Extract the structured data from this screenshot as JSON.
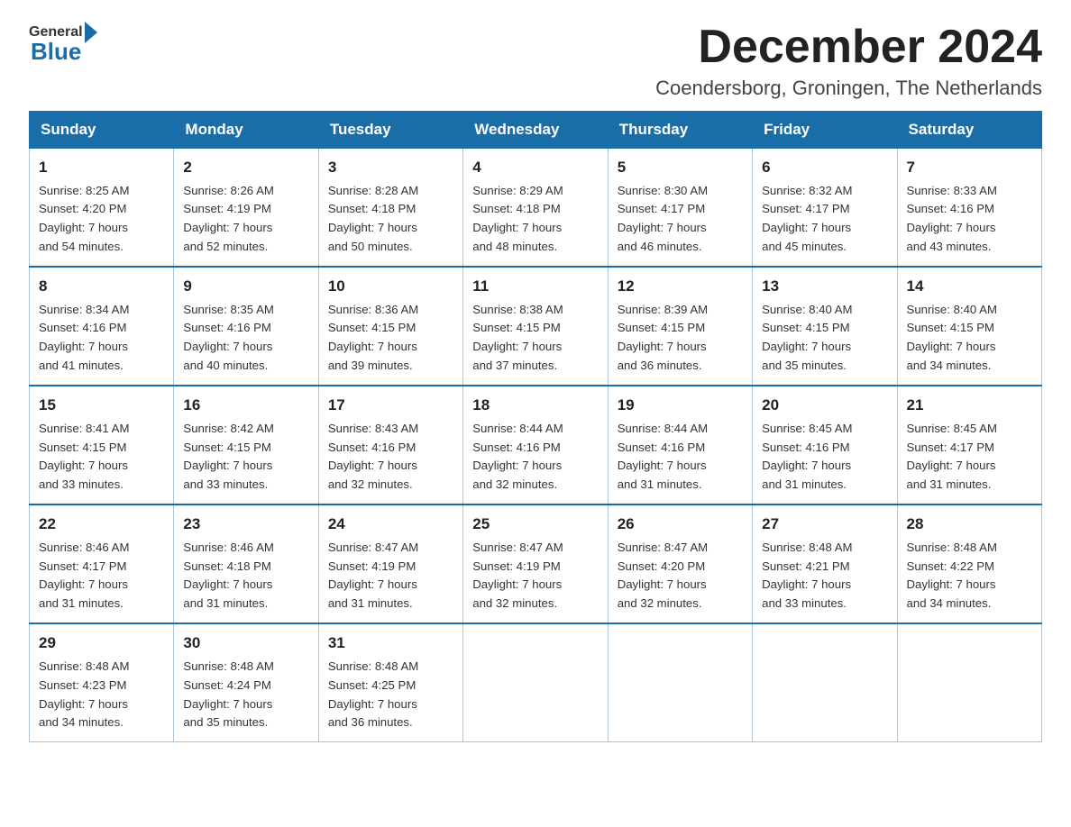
{
  "header": {
    "logo_general": "General",
    "logo_blue": "Blue",
    "month_title": "December 2024",
    "location": "Coendersborg, Groningen, The Netherlands"
  },
  "days_of_week": [
    "Sunday",
    "Monday",
    "Tuesday",
    "Wednesday",
    "Thursday",
    "Friday",
    "Saturday"
  ],
  "weeks": [
    [
      {
        "day": "1",
        "sunrise": "8:25 AM",
        "sunset": "4:20 PM",
        "daylight": "7 hours and 54 minutes."
      },
      {
        "day": "2",
        "sunrise": "8:26 AM",
        "sunset": "4:19 PM",
        "daylight": "7 hours and 52 minutes."
      },
      {
        "day": "3",
        "sunrise": "8:28 AM",
        "sunset": "4:18 PM",
        "daylight": "7 hours and 50 minutes."
      },
      {
        "day": "4",
        "sunrise": "8:29 AM",
        "sunset": "4:18 PM",
        "daylight": "7 hours and 48 minutes."
      },
      {
        "day": "5",
        "sunrise": "8:30 AM",
        "sunset": "4:17 PM",
        "daylight": "7 hours and 46 minutes."
      },
      {
        "day": "6",
        "sunrise": "8:32 AM",
        "sunset": "4:17 PM",
        "daylight": "7 hours and 45 minutes."
      },
      {
        "day": "7",
        "sunrise": "8:33 AM",
        "sunset": "4:16 PM",
        "daylight": "7 hours and 43 minutes."
      }
    ],
    [
      {
        "day": "8",
        "sunrise": "8:34 AM",
        "sunset": "4:16 PM",
        "daylight": "7 hours and 41 minutes."
      },
      {
        "day": "9",
        "sunrise": "8:35 AM",
        "sunset": "4:16 PM",
        "daylight": "7 hours and 40 minutes."
      },
      {
        "day": "10",
        "sunrise": "8:36 AM",
        "sunset": "4:15 PM",
        "daylight": "7 hours and 39 minutes."
      },
      {
        "day": "11",
        "sunrise": "8:38 AM",
        "sunset": "4:15 PM",
        "daylight": "7 hours and 37 minutes."
      },
      {
        "day": "12",
        "sunrise": "8:39 AM",
        "sunset": "4:15 PM",
        "daylight": "7 hours and 36 minutes."
      },
      {
        "day": "13",
        "sunrise": "8:40 AM",
        "sunset": "4:15 PM",
        "daylight": "7 hours and 35 minutes."
      },
      {
        "day": "14",
        "sunrise": "8:40 AM",
        "sunset": "4:15 PM",
        "daylight": "7 hours and 34 minutes."
      }
    ],
    [
      {
        "day": "15",
        "sunrise": "8:41 AM",
        "sunset": "4:15 PM",
        "daylight": "7 hours and 33 minutes."
      },
      {
        "day": "16",
        "sunrise": "8:42 AM",
        "sunset": "4:15 PM",
        "daylight": "7 hours and 33 minutes."
      },
      {
        "day": "17",
        "sunrise": "8:43 AM",
        "sunset": "4:16 PM",
        "daylight": "7 hours and 32 minutes."
      },
      {
        "day": "18",
        "sunrise": "8:44 AM",
        "sunset": "4:16 PM",
        "daylight": "7 hours and 32 minutes."
      },
      {
        "day": "19",
        "sunrise": "8:44 AM",
        "sunset": "4:16 PM",
        "daylight": "7 hours and 31 minutes."
      },
      {
        "day": "20",
        "sunrise": "8:45 AM",
        "sunset": "4:16 PM",
        "daylight": "7 hours and 31 minutes."
      },
      {
        "day": "21",
        "sunrise": "8:45 AM",
        "sunset": "4:17 PM",
        "daylight": "7 hours and 31 minutes."
      }
    ],
    [
      {
        "day": "22",
        "sunrise": "8:46 AM",
        "sunset": "4:17 PM",
        "daylight": "7 hours and 31 minutes."
      },
      {
        "day": "23",
        "sunrise": "8:46 AM",
        "sunset": "4:18 PM",
        "daylight": "7 hours and 31 minutes."
      },
      {
        "day": "24",
        "sunrise": "8:47 AM",
        "sunset": "4:19 PM",
        "daylight": "7 hours and 31 minutes."
      },
      {
        "day": "25",
        "sunrise": "8:47 AM",
        "sunset": "4:19 PM",
        "daylight": "7 hours and 32 minutes."
      },
      {
        "day": "26",
        "sunrise": "8:47 AM",
        "sunset": "4:20 PM",
        "daylight": "7 hours and 32 minutes."
      },
      {
        "day": "27",
        "sunrise": "8:48 AM",
        "sunset": "4:21 PM",
        "daylight": "7 hours and 33 minutes."
      },
      {
        "day": "28",
        "sunrise": "8:48 AM",
        "sunset": "4:22 PM",
        "daylight": "7 hours and 34 minutes."
      }
    ],
    [
      {
        "day": "29",
        "sunrise": "8:48 AM",
        "sunset": "4:23 PM",
        "daylight": "7 hours and 34 minutes."
      },
      {
        "day": "30",
        "sunrise": "8:48 AM",
        "sunset": "4:24 PM",
        "daylight": "7 hours and 35 minutes."
      },
      {
        "day": "31",
        "sunrise": "8:48 AM",
        "sunset": "4:25 PM",
        "daylight": "7 hours and 36 minutes."
      },
      null,
      null,
      null,
      null
    ]
  ],
  "labels": {
    "sunrise": "Sunrise:",
    "sunset": "Sunset:",
    "daylight": "Daylight:"
  }
}
